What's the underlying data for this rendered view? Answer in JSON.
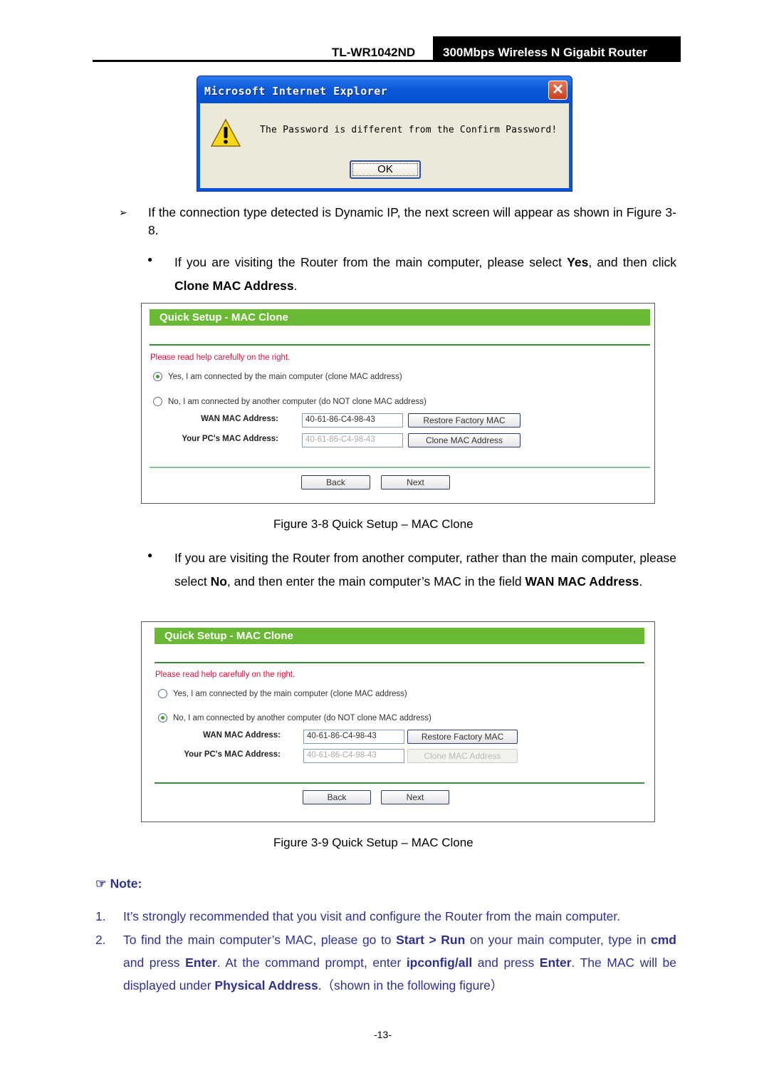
{
  "header": {
    "model": "TL-WR1042ND",
    "title": "300Mbps Wireless N Gigabit Router"
  },
  "ie_dialog": {
    "title": "Microsoft Internet Explorer",
    "message": "The Password is different from the Confirm Password!",
    "ok_label": "OK",
    "icon": "warning-icon"
  },
  "para1": {
    "bullet": "➢",
    "text": "If the connection type detected is Dynamic IP, the next screen will appear as shown in Figure 3-8."
  },
  "para2": {
    "pre": "If you are visiting the Router from the main computer, please select ",
    "b1": "Yes",
    "mid": ", and then click ",
    "b2": "Clone MAC Address",
    "post": "."
  },
  "para3": {
    "pre": "If you are visiting the Router from another computer, rather than the main computer, please select ",
    "b1": "No",
    "mid": ", and then enter the main computer’s MAC in the field ",
    "b2": "WAN MAC Address",
    "post": "."
  },
  "panels": [
    {
      "title": "Quick Setup - MAC Clone",
      "help": "Please read help carefully on the right.",
      "option_yes": "Yes, I am connected by the main computer (clone MAC address)",
      "option_no": "No, I am connected by another computer (do NOT clone MAC address)",
      "selected": "yes",
      "wan_label": "WAN MAC Address:",
      "wan_value": "40-61-86-C4-98-43",
      "pc_label": "Your PC's MAC Address:",
      "pc_value": "40-61-86-C4-98-43",
      "restore_label": "Restore Factory MAC",
      "clone_label": "Clone MAC Address",
      "clone_enabled": true,
      "back_label": "Back",
      "next_label": "Next",
      "caption": "Figure 3-8    Quick Setup – MAC Clone"
    },
    {
      "title": "Quick Setup - MAC Clone",
      "help": "Please read help carefully on the right.",
      "option_yes": "Yes, I am connected by the main computer (clone MAC address)",
      "option_no": "No, I am connected by another computer (do NOT clone MAC address)",
      "selected": "no",
      "wan_label": "WAN MAC Address:",
      "wan_value": "40-61-86-C4-98-43",
      "pc_label": "Your PC's MAC Address:",
      "pc_value": "40-61-86-C4-98-43",
      "restore_label": "Restore Factory MAC",
      "clone_label": "Clone MAC Address",
      "clone_enabled": false,
      "back_label": "Back",
      "next_label": "Next",
      "caption": "Figure 3-9    Quick Setup – MAC Clone"
    }
  ],
  "note": {
    "icon": "pointing-hand-icon",
    "label": "Note:",
    "item1_num": "1.",
    "item1": "It’s strongly recommended that you visit and configure the Router from the main computer.",
    "item2_num": "2.",
    "item2": {
      "t1": "To find the main computer’s MAC, please go to ",
      "b1": "Start > Run",
      "t2": " on your main computer, type in ",
      "b2": "cmd",
      "t3": " and press ",
      "b3": "Enter",
      "t4": ". At the command prompt, enter ",
      "b4": "ipconfig/all",
      "t5": " and press ",
      "b5": "Enter",
      "t6": ". The MAC will be displayed under ",
      "b6": "Physical Address",
      "t7": ".（shown in the following figure）"
    }
  },
  "page_number": "-13-"
}
